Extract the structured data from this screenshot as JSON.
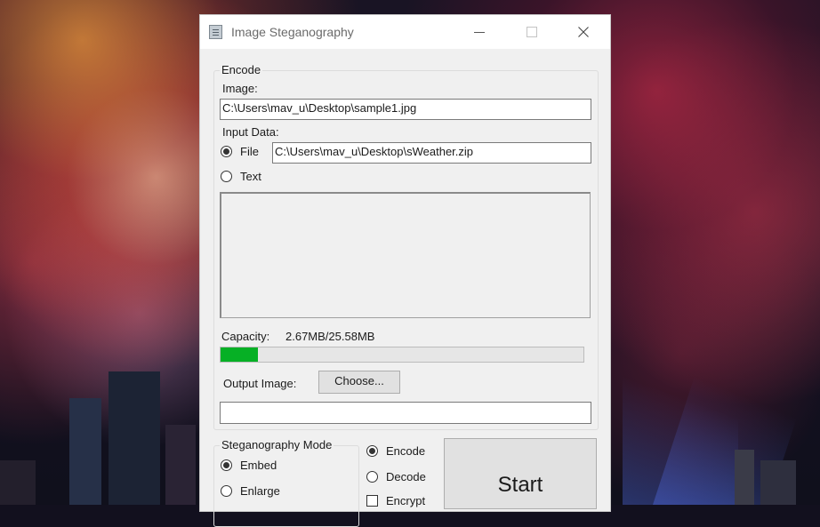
{
  "window": {
    "title": "Image Steganography",
    "accent_color": "#06b025"
  },
  "encode_group": {
    "legend": "Encode",
    "image_label": "Image:",
    "image_path": "C:\\Users\\mav_u\\Desktop\\sample1.jpg",
    "input_data_label": "Input Data:",
    "file_option": {
      "label": "File",
      "checked": true
    },
    "file_path": "C:\\Users\\mav_u\\Desktop\\sWeather.zip",
    "text_option": {
      "label": "Text",
      "checked": false
    },
    "text_content": "",
    "capacity_label": "Capacity:",
    "capacity_value": "2.67MB/25.58MB",
    "capacity_fraction": 0.104,
    "output_image_label": "Output Image:",
    "choose_button": "Choose...",
    "output_path": ""
  },
  "mode_group": {
    "legend": "Steganography Mode",
    "options": [
      {
        "label": "Embed",
        "checked": true
      },
      {
        "label": "Enlarge",
        "checked": false
      }
    ]
  },
  "operation": {
    "options": [
      {
        "label": "Encode",
        "checked": true
      },
      {
        "label": "Decode",
        "checked": false
      }
    ],
    "encrypt": {
      "label": "Encrypt",
      "checked": false
    }
  },
  "start_button": "Start"
}
